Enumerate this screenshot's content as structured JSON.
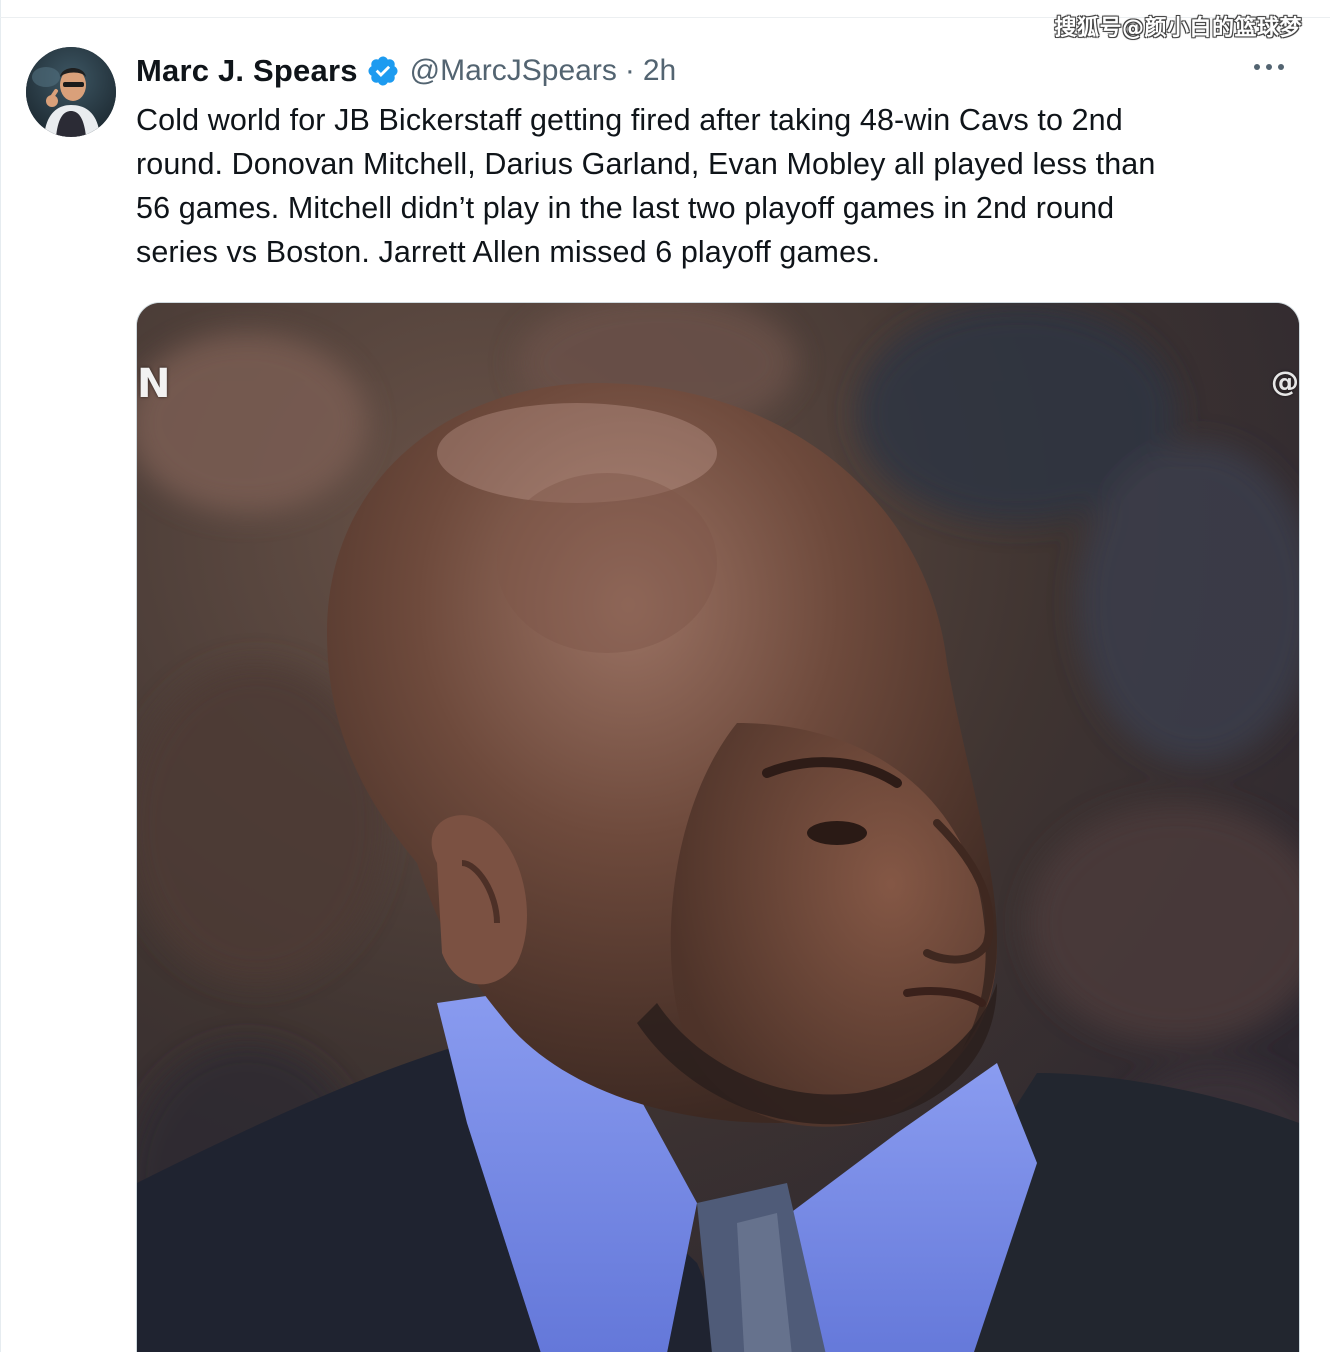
{
  "watermark": {
    "text": "搜狐号@颜小白的篮球梦"
  },
  "tweet": {
    "author": {
      "name": "Marc J. Spears",
      "handle": "@MarcJSpears",
      "separator": "·",
      "time": "2h",
      "verified": true,
      "verified_color": "#1d9bf0"
    },
    "more_menu_icon": "more-horizontal-icon",
    "text_lines": [
      "Cold world for JB Bickerstaff getting fired after taking 48-win Cavs to 2nd",
      "round. Donovan Mitchell, Darius Garland, Evan Mobley all played less than",
      "56 games. Mitchell didn’t play in the last two playoff games in 2nd round",
      "series vs Boston. Jarrett Allen missed 6 playoff games."
    ],
    "media": {
      "overlay_left": "N",
      "overlay_right": "@"
    }
  },
  "colors": {
    "text_primary": "#0f1419",
    "text_secondary": "#536471",
    "border": "#cfd9de",
    "accent": "#1d9bf0"
  }
}
